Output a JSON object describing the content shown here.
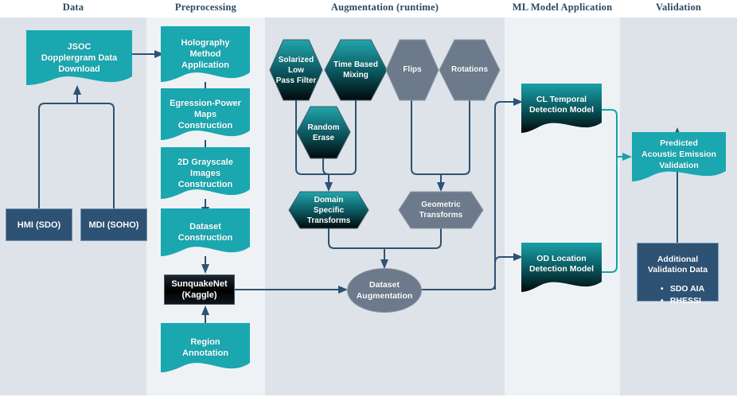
{
  "lanes": [
    {
      "id": "data",
      "title": "Data"
    },
    {
      "id": "prep",
      "title": "Preprocessing"
    },
    {
      "id": "aug",
      "title": "Augmentation (runtime)"
    },
    {
      "id": "ml",
      "title": "ML Model Application"
    },
    {
      "id": "val",
      "title": "Validation"
    }
  ],
  "colors": {
    "teal": "#1aa7b0",
    "teal_dark": "#0b6b72",
    "navy": "#2d5274",
    "gray": "#6c7a8c",
    "black": "#000000",
    "lane_dark": "#dde3e9",
    "lane_light": "#eff2f4",
    "header_text": "#2a4a63"
  },
  "nodes": {
    "jsoc": {
      "label": "JSOC\nDopplergram Data\nDownload",
      "shape": "document",
      "fill": "teal"
    },
    "hmi": {
      "label": "HMI (SDO)",
      "shape": "rect",
      "fill": "navy"
    },
    "mdi": {
      "label": "MDI (SOHO)",
      "shape": "rect",
      "fill": "navy"
    },
    "holography": {
      "label": "Holography\nMethod\nApplication",
      "shape": "document",
      "fill": "teal"
    },
    "egression": {
      "label": "Egression-Power\nMaps\nConstruction",
      "shape": "document",
      "fill": "teal"
    },
    "grayscale": {
      "label": "2D Grayscale\nImages\nConstruction",
      "shape": "document",
      "fill": "teal"
    },
    "dataset": {
      "label": "Dataset\nConstruction",
      "shape": "document",
      "fill": "teal"
    },
    "sunquakenet": {
      "label": "SunquakeNet\n(Kaggle)",
      "shape": "rect",
      "fill": "black"
    },
    "region": {
      "label": "Region\nAnnotation",
      "shape": "document",
      "fill": "teal"
    },
    "solarized": {
      "label": "Solarized\nLow\nPass Filter",
      "shape": "hexagon",
      "fill": "teal-black"
    },
    "timemix": {
      "label": "Time Based\nMixing",
      "shape": "hexagon",
      "fill": "teal-black"
    },
    "randomerase": {
      "label": "Random\nErase",
      "shape": "hexagon",
      "fill": "teal-black"
    },
    "flips": {
      "label": "Flips",
      "shape": "hexagon",
      "fill": "gray"
    },
    "rotations": {
      "label": "Rotations",
      "shape": "hexagon",
      "fill": "gray"
    },
    "domain": {
      "label": "Domain\nSpecific\nTransforms",
      "shape": "hexagon",
      "fill": "teal-black"
    },
    "geometric": {
      "label": "Geometric\nTransforms",
      "shape": "hexagon",
      "fill": "gray"
    },
    "augmentation": {
      "label": "Dataset\nAugmentation",
      "shape": "ellipse",
      "fill": "gray"
    },
    "cltemporal": {
      "label": "CL Temporal\nDetection Model",
      "shape": "document",
      "fill": "teal-black"
    },
    "odlocation": {
      "label": "OD Location\nDetection Model",
      "shape": "document",
      "fill": "teal-black"
    },
    "predicted": {
      "label": "Predicted\nAcoustic Emission\nValidation",
      "shape": "document",
      "fill": "teal"
    },
    "addvalidation": {
      "label": "Additional\nValidation Data",
      "shape": "rect",
      "fill": "navy",
      "bullets": [
        "SDO AIA",
        "RHESSI"
      ]
    }
  }
}
